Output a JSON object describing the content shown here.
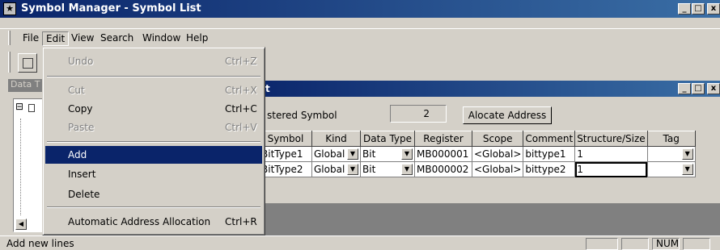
{
  "window": {
    "title": "Symbol Manager - Symbol List",
    "app_icon": "star-icon",
    "controls": [
      "_",
      "□",
      "x"
    ]
  },
  "menubar": {
    "items": [
      "File",
      "Edit",
      "View",
      "Search",
      "Window",
      "Help"
    ],
    "active": "Edit"
  },
  "edit_menu": {
    "items": [
      {
        "label": "Undo",
        "shortcut": "Ctrl+Z",
        "enabled": false
      },
      {
        "label": "Cut",
        "shortcut": "Ctrl+X",
        "enabled": false
      },
      {
        "label": "Copy",
        "shortcut": "Ctrl+C",
        "enabled": true
      },
      {
        "label": "Paste",
        "shortcut": "Ctrl+V",
        "enabled": false
      },
      {
        "label": "Add",
        "shortcut": "",
        "enabled": true,
        "selected": true
      },
      {
        "label": "Insert",
        "shortcut": "",
        "enabled": true
      },
      {
        "label": "Delete",
        "shortcut": "",
        "enabled": true
      },
      {
        "label": "Automatic Address Allocation",
        "shortcut": "Ctrl+R",
        "enabled": true
      }
    ]
  },
  "left_panel": {
    "title_fragment": "Data T",
    "tree_toggle": "⊟"
  },
  "child_window": {
    "title_fragment": "t",
    "registered_label": "stered Symbol",
    "registered_count": "2",
    "allocate_button": "Alocate Address"
  },
  "table": {
    "headers": [
      "Symbol",
      "Kind",
      "Data Type",
      "Register",
      "Scope",
      "Comment",
      "Structure/Size",
      "Tag"
    ],
    "rows": [
      {
        "symbol": "BitType1",
        "kind": "Global",
        "data_type": "Bit",
        "register": "MB000001",
        "scope": "<Global>",
        "comment": "bittype1",
        "structure_size": "1",
        "tag": ""
      },
      {
        "symbol": "BitType2",
        "kind": "Global",
        "data_type": "Bit",
        "register": "MB000002",
        "scope": "<Global>",
        "comment": "bittype2",
        "structure_size": "1",
        "tag": ""
      }
    ]
  },
  "statusbar": {
    "message": "Add new lines",
    "panes": [
      "",
      "",
      "NUM",
      ""
    ]
  }
}
